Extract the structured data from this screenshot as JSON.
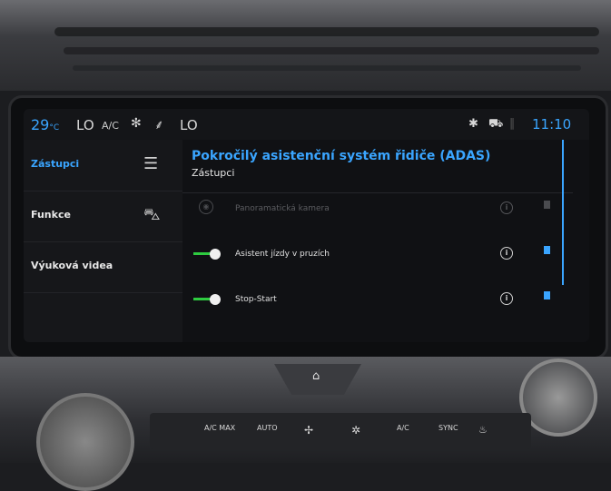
{
  "status": {
    "temp_value": "29",
    "temp_unit": "°C",
    "left_level": "LO",
    "ac_label": "A/C",
    "fan_icon": "fan-icon",
    "seat_icon": "seat-heat-icon",
    "right_level": "LO",
    "bluetooth_icon": "bluetooth-icon",
    "car_icon": "car-icon",
    "signal_icon": "signal-icon",
    "time": "11:10"
  },
  "nav": {
    "items": [
      {
        "label": "Zástupci",
        "active": true,
        "icon": "menu-icon"
      },
      {
        "label": "Funkce",
        "active": false,
        "icon": "car-icon"
      },
      {
        "label": "Výuková videa",
        "active": false,
        "icon": ""
      }
    ]
  },
  "main": {
    "title": "Pokročilý asistenční systém řidiče (ADAS)",
    "subtitle": "Zástupci",
    "rows": [
      {
        "label": "Panoramatická kamera",
        "enabled": false,
        "has_toggle": false,
        "bookmarked": false
      },
      {
        "label": "Asistent jízdy v pruzích",
        "enabled": true,
        "has_toggle": true,
        "toggle_on": true,
        "bookmarked": true
      },
      {
        "label": "Stop-Start",
        "enabled": true,
        "has_toggle": true,
        "toggle_on": true,
        "bookmarked": true
      }
    ]
  },
  "console": {
    "home_icon": "home-icon",
    "keys": [
      "A/C MAX",
      "AUTO",
      "A/C"
    ],
    "sync_label": "SYNC"
  },
  "colors": {
    "accent": "#3aa5ff",
    "toggle_on": "#2ecc40"
  }
}
